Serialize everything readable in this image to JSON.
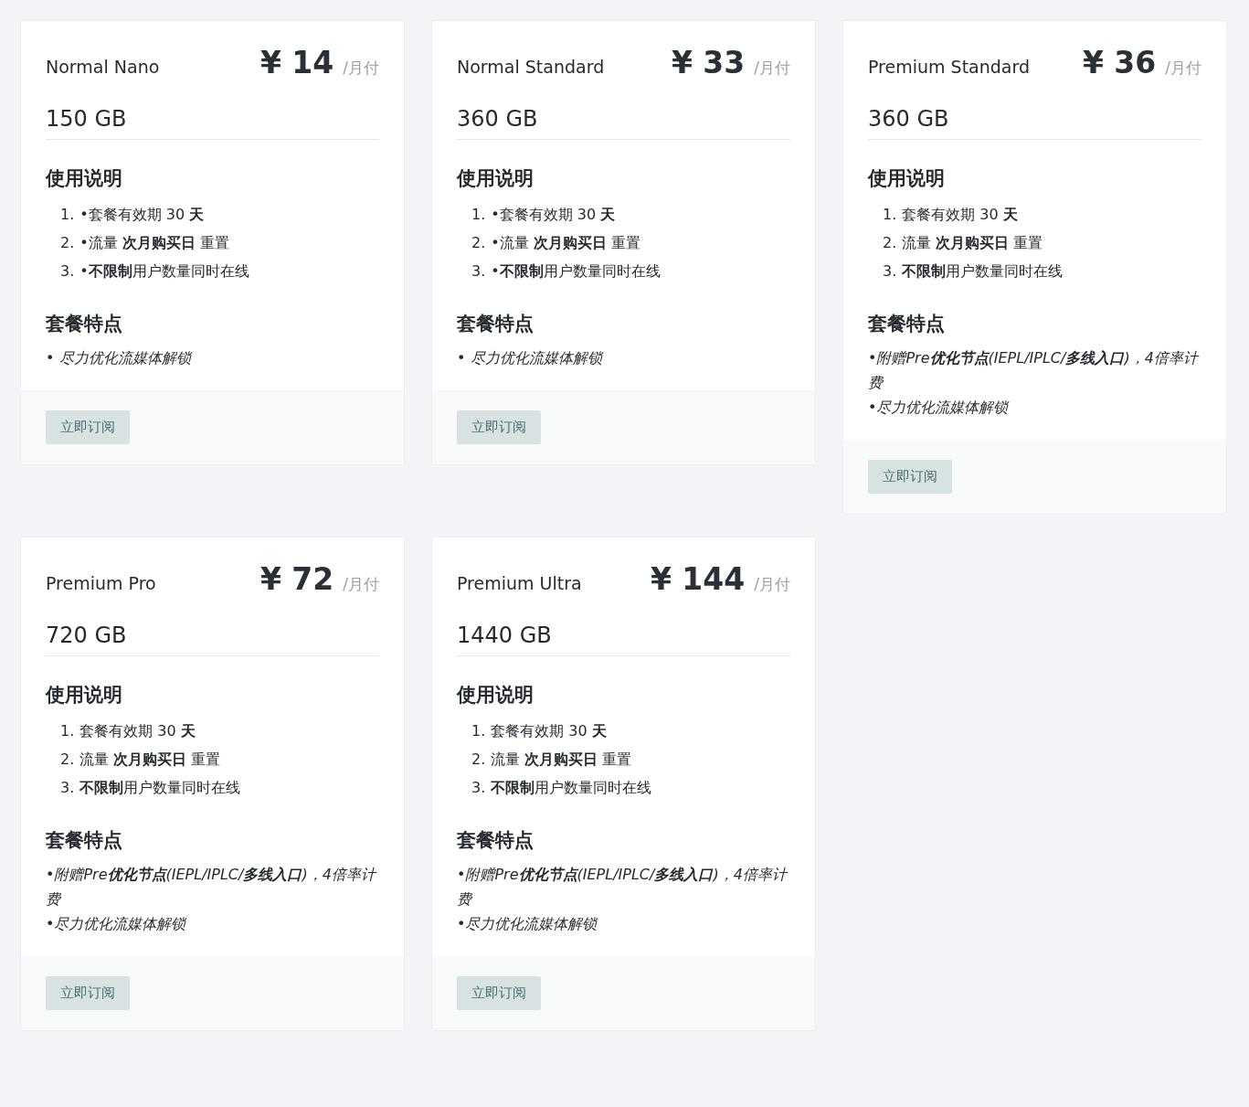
{
  "plans": [
    {
      "name": "Normal Nano",
      "currency": "¥",
      "price": "14",
      "period": "/月付",
      "traffic": "150 GB",
      "usage_heading": "使用说明",
      "usage": [
        {
          "number": "1.",
          "text": "•套餐有效期 30 **天**"
        },
        {
          "number": "2.",
          "text": "•流量 **次月购买日** 重置"
        },
        {
          "number": "3.",
          "text": "•**不限制**用户数量同时在线"
        }
      ],
      "features_heading": "套餐特点",
      "features": [
        "• 尽力优化流媒体解锁"
      ],
      "button": "立即订阅"
    },
    {
      "name": "Normal Standard",
      "currency": "¥",
      "price": "33",
      "period": "/月付",
      "traffic": "360 GB",
      "usage_heading": "使用说明",
      "usage": [
        {
          "number": "1.",
          "text": "•套餐有效期 30 **天**"
        },
        {
          "number": "2.",
          "text": "•流量 **次月购买日** 重置"
        },
        {
          "number": "3.",
          "text": "•**不限制**用户数量同时在线"
        }
      ],
      "features_heading": "套餐特点",
      "features": [
        "• 尽力优化流媒体解锁"
      ],
      "button": "立即订阅"
    },
    {
      "name": "Premium Standard",
      "currency": "¥",
      "price": "36",
      "period": "/月付",
      "traffic": "360 GB",
      "usage_heading": "使用说明",
      "usage": [
        {
          "number": "1.",
          "text": "套餐有效期 30 **天**"
        },
        {
          "number": "2.",
          "text": "流量 **次月购买日** 重置"
        },
        {
          "number": "3.",
          "text": "**不限制**用户数量同时在线"
        }
      ],
      "features_heading": "套餐特点",
      "features": [
        "•附赠Pre**优化节点**(IEPL/IPLC/**多线入口**)，4倍率计费",
        "•尽力优化流媒体解锁"
      ],
      "button": "立即订阅"
    },
    {
      "name": "Premium Pro",
      "currency": "¥",
      "price": "72",
      "period": "/月付",
      "traffic": "720 GB",
      "usage_heading": "使用说明",
      "usage": [
        {
          "number": "1.",
          "text": "套餐有效期 30 **天**"
        },
        {
          "number": "2.",
          "text": "流量 **次月购买日** 重置"
        },
        {
          "number": "3.",
          "text": "**不限制**用户数量同时在线"
        }
      ],
      "features_heading": "套餐特点",
      "features": [
        "•附赠Pre**优化节点**(IEPL/IPLC/**多线入口**)，4倍率计费",
        "•尽力优化流媒体解锁"
      ],
      "button": "立即订阅"
    },
    {
      "name": "Premium Ultra",
      "currency": "¥",
      "price": "144",
      "period": "/月付",
      "traffic": "1440 GB",
      "usage_heading": "使用说明",
      "usage": [
        {
          "number": "1.",
          "text": "套餐有效期 30 **天**"
        },
        {
          "number": "2.",
          "text": "流量 **次月购买日** 重置"
        },
        {
          "number": "3.",
          "text": "**不限制**用户数量同时在线"
        }
      ],
      "features_heading": "套餐特点",
      "features": [
        "•附赠Pre**优化节点**(IEPL/IPLC/**多线入口**)，4倍率计费",
        "•尽力优化流媒体解锁"
      ],
      "button": "立即订阅"
    }
  ]
}
